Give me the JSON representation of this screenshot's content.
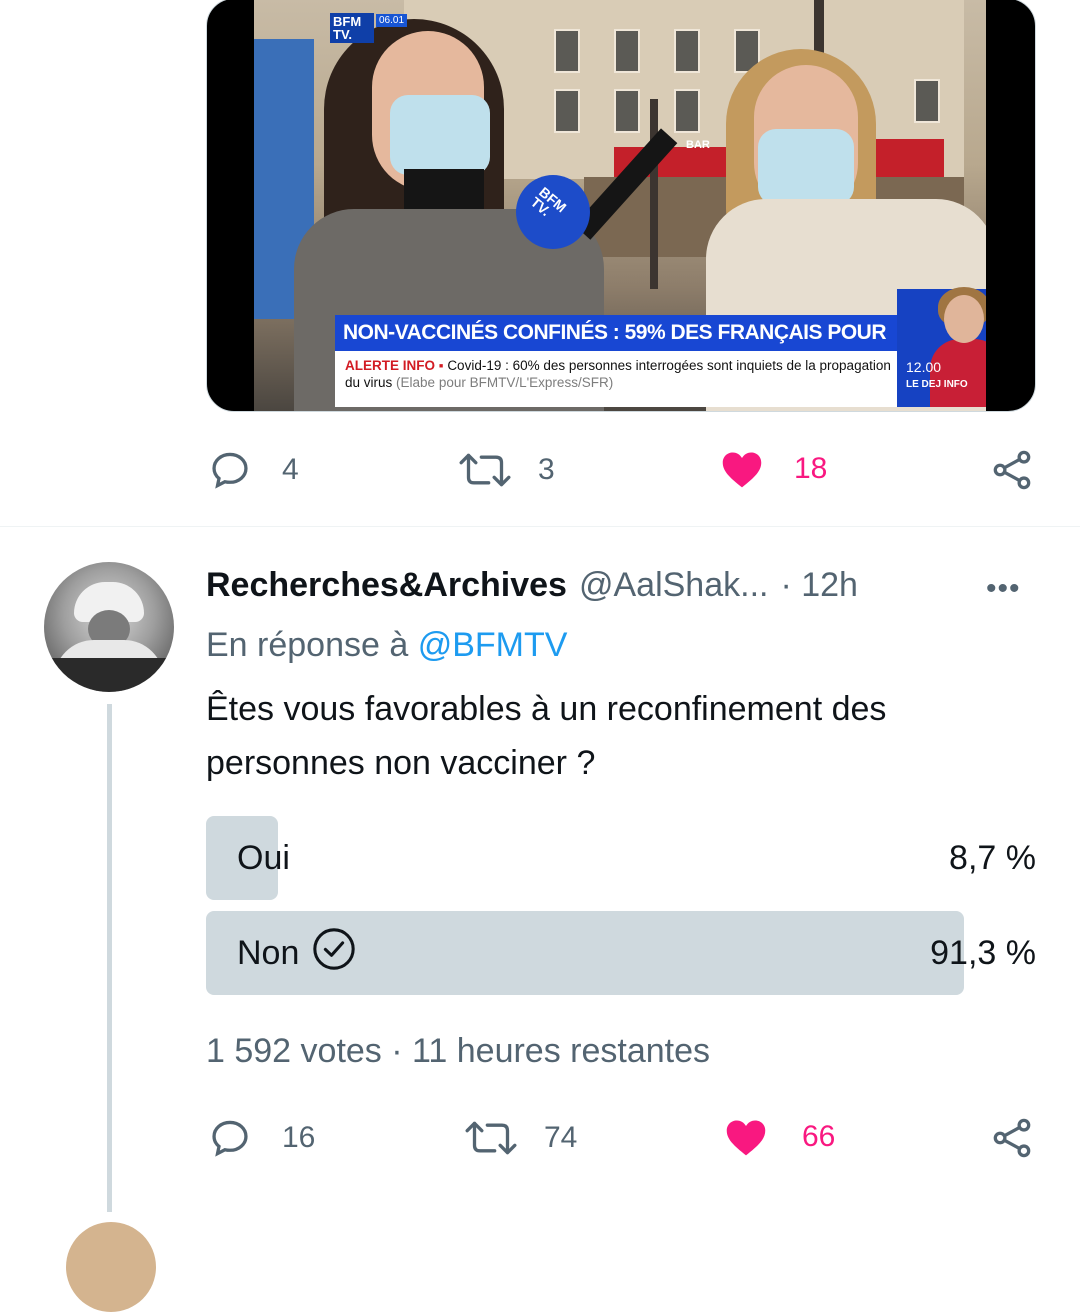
{
  "top_tweet": {
    "media": {
      "channel_logo": "BFM TV.",
      "channel_time": "06.01",
      "mic_logo": "BFM TV.",
      "shop_sign": "BAR",
      "headline": "NON-VACCINÉS CONFINÉS : 59% DES FRANÇAIS POUR",
      "alert_label": "ALERTE INFO",
      "alert_text": "Covid-19 : 60% des personnes interrogées sont inquiets de la propagation du virus",
      "alert_source": "(Elabe pour BFMTV/L'Express/SFR)",
      "anchor_time": "12.00",
      "anchor_show": "LE DEJ INFO"
    },
    "actions": {
      "replies": "4",
      "retweets": "3",
      "likes": "18",
      "liked": true
    }
  },
  "reply_tweet": {
    "display_name": "Recherches&Archives",
    "handle": "@AalShak...",
    "time": "· 12h",
    "more": "•••",
    "reply_prefix": "En réponse à",
    "reply_mention": "@BFMTV",
    "text_line1": "Êtes vous favorables à un reconfinement des",
    "text_line2": "personnes non vacciner ?",
    "poll": {
      "options": [
        {
          "label": "Oui",
          "percent_text": "8,7 %",
          "fraction": 0.087,
          "voted": false
        },
        {
          "label": "Non",
          "percent_text": "91,3 %",
          "fraction": 0.913,
          "voted": true
        }
      ],
      "meta": "1 592 votes · 11 heures restantes"
    },
    "actions": {
      "replies": "16",
      "retweets": "74",
      "likes": "66",
      "liked": true
    }
  },
  "icons": {
    "reply": "speech-bubble-icon",
    "retweet": "retweet-icon",
    "like": "heart-icon",
    "share": "share-icon",
    "more": "more-dots-icon",
    "check": "check-circle-icon"
  },
  "colors": {
    "like_pink": "#f91880",
    "link_blue": "#1d9bf0",
    "muted": "#536471",
    "poll_bar": "#cfd9de"
  }
}
